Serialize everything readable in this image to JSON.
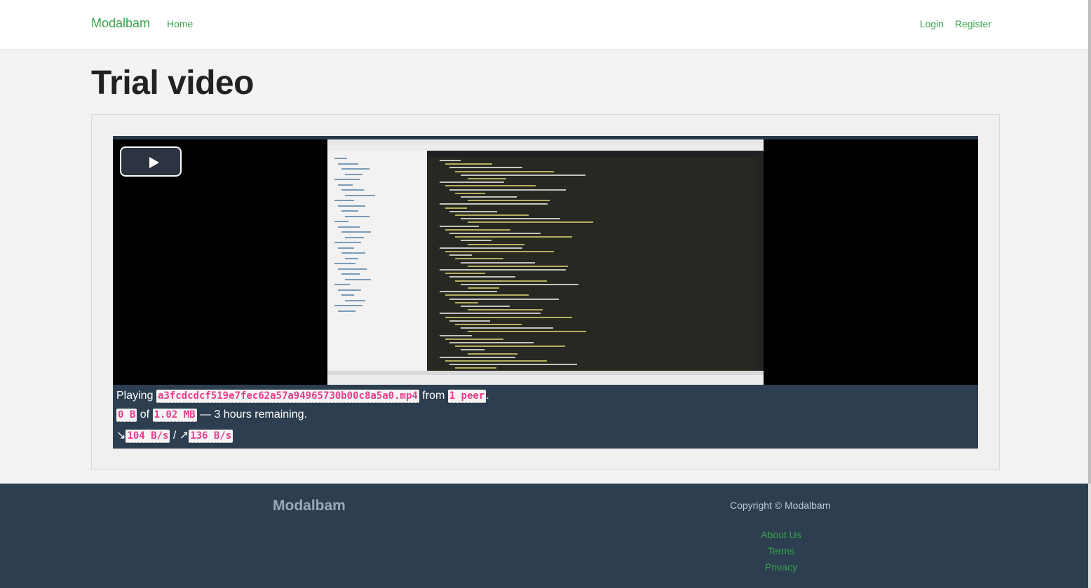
{
  "navbar": {
    "brand": "Modalbam",
    "home": "Home",
    "login": "Login",
    "register": "Register"
  },
  "page": {
    "title": "Trial video"
  },
  "player": {
    "play_icon": "play-icon",
    "playing_label": "Playing",
    "file_name": "a3fcdcdcf519e7fec62a57a94965730b00c8a5a0.mp4",
    "from_label": "from",
    "peers": "1 peer",
    "period": ".",
    "downloaded": "0 B",
    "of_label": "of",
    "total_size": "1.02 MB",
    "remaining": "— 3 hours remaining.",
    "download_arrow": "↘",
    "download_speed": "104 B/s",
    "separator": "/",
    "upload_arrow": "↗",
    "upload_speed": "136 B/s"
  },
  "footer": {
    "brand": "Modalbam",
    "copyright": "Copyright © Modalbam",
    "links": [
      "About Us",
      "Terms",
      "Privacy"
    ]
  },
  "colors": {
    "accent": "#38a24d",
    "dark": "#2c3e50",
    "code": "#e83e8c"
  }
}
